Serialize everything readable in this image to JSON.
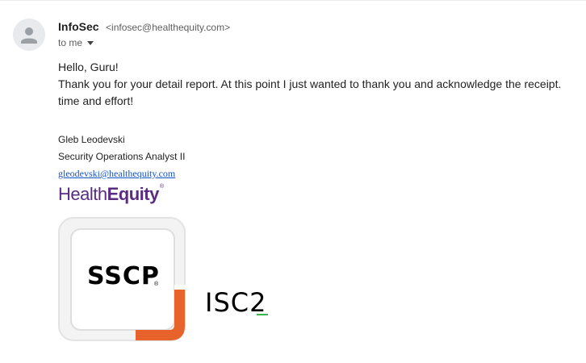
{
  "sender": {
    "name": "InfoSec",
    "email": "<infosec@healthequity.com>"
  },
  "recipient": {
    "label": "to me"
  },
  "body": {
    "greeting": "Hello, Guru!",
    "line1": "Thank you for your detail report. At this point I just wanted to thank you and acknowledge the receipt.",
    "line2": "time and effort!"
  },
  "signature": {
    "name": "Gleb Leodevski",
    "title": "Security Operations Analyst II",
    "email": "gleodevski@healthequity.com"
  },
  "logos": {
    "brand_part1": "Health",
    "brand_part2": "Equity",
    "brand_mark": "®",
    "brand_color": "#5a2d82",
    "badge_text": "SSCP",
    "badge_reg": "®",
    "badge_accent": "#e8622c",
    "isc_text": "ISC2",
    "isc_accent": "#3bb54a"
  },
  "icons": {
    "avatar": "person-avatar-icon",
    "recipient_toggle": "caret-down-icon"
  }
}
